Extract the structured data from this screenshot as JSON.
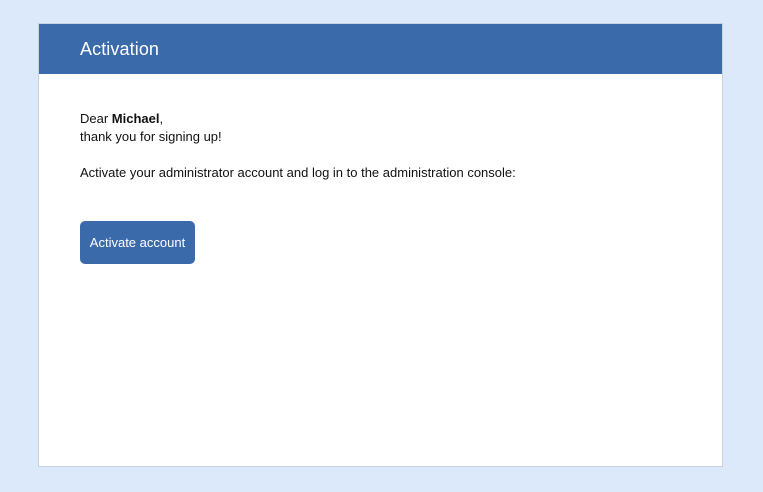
{
  "header": {
    "title": "Activation"
  },
  "message": {
    "salutation": "Dear ",
    "name": "Michael",
    "salutation_suffix": ",",
    "thanks": "thank you for signing up!",
    "instruction": "Activate your administrator account and log in to the administration console:"
  },
  "actions": {
    "activate_label": "Activate account"
  },
  "colors": {
    "background": "#dce9fb",
    "brand": "#3b6aaa",
    "card": "#ffffff"
  }
}
